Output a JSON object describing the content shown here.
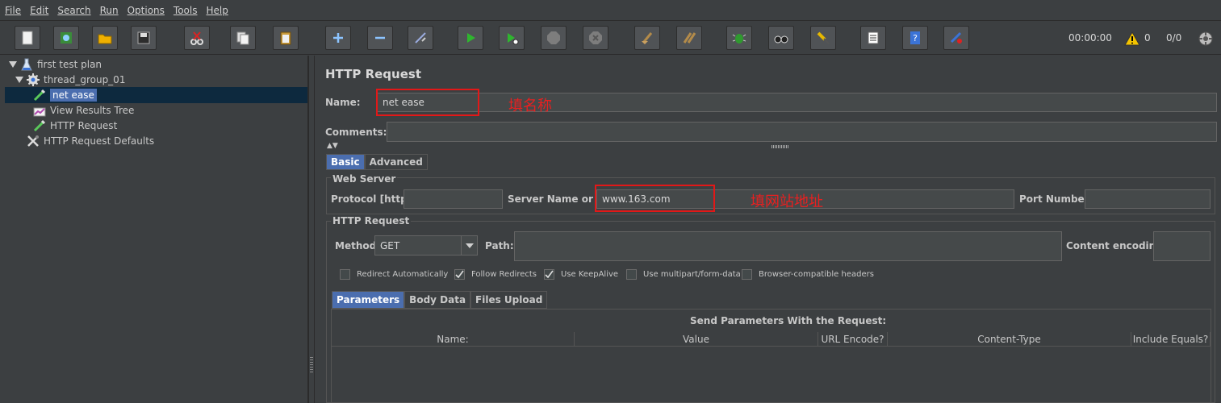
{
  "menu": [
    "File",
    "Edit",
    "Search",
    "Run",
    "Options",
    "Tools",
    "Help"
  ],
  "toolbar": {
    "timer": "00:00:00",
    "warnings_count": "0",
    "thread_ratio": "0/0"
  },
  "tree": {
    "items": [
      {
        "label": "first test plan",
        "icon": "flask-icon"
      },
      {
        "label": "thread_group_01",
        "icon": "gear-icon"
      },
      {
        "label": "net ease",
        "icon": "pipette-icon",
        "selected": true
      },
      {
        "label": "View Results Tree",
        "icon": "graph-icon"
      },
      {
        "label": "HTTP Request",
        "icon": "pipette-icon"
      },
      {
        "label": "HTTP Request Defaults",
        "icon": "wrench-icon"
      }
    ]
  },
  "panel": {
    "title": "HTTP Request",
    "name_label": "Name:",
    "name_value": "net ease",
    "name_annotation": "填名称",
    "comments_label": "Comments:",
    "comments_value": "",
    "tabs": [
      "Basic",
      "Advanced"
    ],
    "web_server": {
      "title": "Web Server",
      "protocol_label": "Protocol [http]:",
      "protocol_value": "",
      "server_label": "Server Name or IP:",
      "server_value": "www.163.com",
      "server_annotation": "填网站地址",
      "port_label": "Port Number:",
      "port_value": ""
    },
    "http_request": {
      "title": "HTTP Request",
      "method_label": "Method:",
      "method_value": "GET",
      "path_label": "Path:",
      "path_value": "",
      "encoding_label": "Content encoding:",
      "encoding_value": ""
    },
    "checkboxes": [
      {
        "label": "Redirect Automatically",
        "checked": false
      },
      {
        "label": "Follow Redirects",
        "checked": true
      },
      {
        "label": "Use KeepAlive",
        "checked": true
      },
      {
        "label": "Use multipart/form-data",
        "checked": false
      },
      {
        "label": "Browser-compatible headers",
        "checked": false
      }
    ],
    "param_tabs": [
      "Parameters",
      "Body Data",
      "Files Upload"
    ],
    "params_title": "Send Parameters With the Request:",
    "params_columns": [
      "Name:",
      "Value",
      "URL Encode?",
      "Content-Type",
      "Include Equals?"
    ]
  }
}
